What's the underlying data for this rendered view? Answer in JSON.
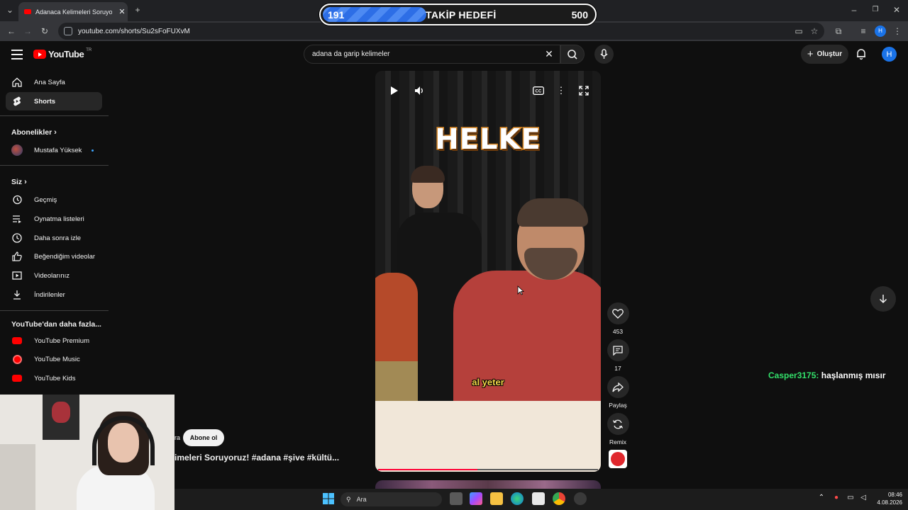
{
  "browser": {
    "tab_title": "Adanaca Kelimeleri Soruyoruz! #",
    "url": "youtube.com/shorts/Su2sFoFUXvM",
    "profile_initial": "H"
  },
  "goal_overlay": {
    "current": "191",
    "label": "TAKİP HEDEFİ",
    "target": "500",
    "progress": 0.382
  },
  "header": {
    "logo_text": "YouTube",
    "region": "TR",
    "search_value": "adana da garip kelimeler",
    "create_label": "Oluştur",
    "avatar_initial": "H"
  },
  "sidebar": {
    "items_top": [
      {
        "label": "Ana Sayfa",
        "icon": "home-icon"
      },
      {
        "label": "Shorts",
        "icon": "shorts-icon",
        "active": true
      }
    ],
    "subscriptions_heading": "Abonelikler",
    "subscriptions": [
      {
        "label": "Mustafa Yüksek"
      }
    ],
    "you_heading": "Siz",
    "you_items": [
      {
        "label": "Geçmiş",
        "icon": "history-icon"
      },
      {
        "label": "Oynatma listeleri",
        "icon": "playlist-icon"
      },
      {
        "label": "Daha sonra izle",
        "icon": "watch-later-icon"
      },
      {
        "label": "Beğendiğim videolar",
        "icon": "like-icon"
      },
      {
        "label": "Videolarınız",
        "icon": "your-videos-icon"
      },
      {
        "label": "İndirilenler",
        "icon": "download-icon"
      }
    ],
    "more_heading": "YouTube'dan daha fazla...",
    "more_items": [
      {
        "label": "YouTube Premium"
      },
      {
        "label": "YouTube Music"
      },
      {
        "label": "YouTube Kids"
      }
    ]
  },
  "player": {
    "overlay_word": "HELKE",
    "subtitle": "al yeter",
    "progress": 0.45
  },
  "actions": {
    "likes": "453",
    "comments": "17",
    "share_label": "Paylaş",
    "remix_label": "Remix"
  },
  "short_info": {
    "channel_fragment": "ra",
    "subscribe_label": "Abone ol",
    "title": "imeleri Soruyoruz! #adana #şive #kültü..."
  },
  "chat": {
    "user": "Casper3175:",
    "message": "haşlanmış mısır"
  },
  "taskbar": {
    "search_label": "Ara",
    "time": "08:46",
    "date": "4.08.2026"
  }
}
